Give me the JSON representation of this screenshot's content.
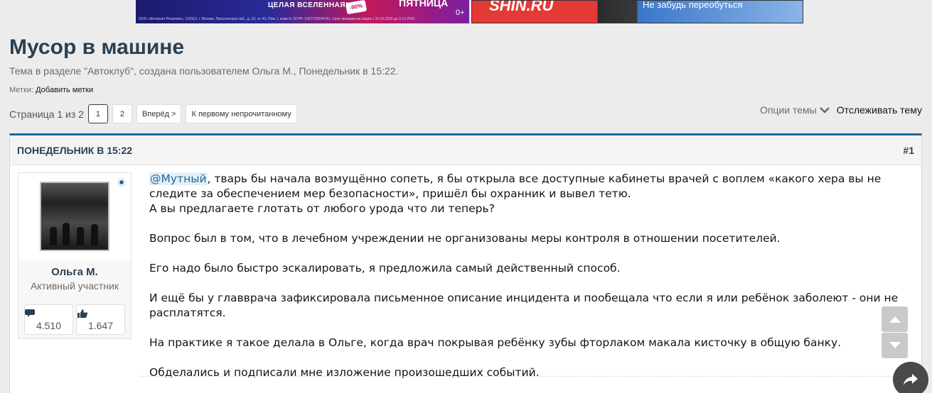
{
  "banners": {
    "left_text_1": "ЦЕЛАЯ ВСЕЛЕННАЯ!",
    "left_badge": "-90%",
    "left_text_2": "ПЯТНИЦА",
    "left_age": "0+",
    "left_fineprint": "ООО «Интернет Решения», 123112, г. Москва, Пресненская наб., д. 10, эт. 41, Пом. I, комн 6; ОГРН: 1027739244741. Срок проведения акции с 30.10.2020 до 3.12.2020.",
    "right_brand": "SHIN.RU",
    "right_text": "Не забудь переобуться"
  },
  "header": {
    "title": "Мусор в машине",
    "subtitle": "Тема в разделе \"Автоклуб\", создана пользователем Ольга М., Понедельник в 15:22.",
    "tags_label": "Метки:",
    "tags_add": "Добавить метки"
  },
  "pager": {
    "label": "Страница 1 из 2",
    "pages": [
      "1",
      "2"
    ],
    "next": "Вперёд >",
    "first_unread": "К первому непрочитанному"
  },
  "thread_tools": {
    "options": "Опции темы",
    "watch": "Отслеживать тему"
  },
  "post": {
    "date": "ПОНЕДЕЛЬНИК В 15:22",
    "number": "#1",
    "mention": "@Мутный",
    "para1_rest": ", тварь бы начала возмущённо сопеть, я бы открыла все доступные кабинеты врачей с воплем «какого хера вы не следите за обеспечением мер безопасности», пришёл бы охранник и вывел тетю.",
    "para1_line2": "А вы предлагаете глотать от любого урода что ли теперь?",
    "para2": "Вопрос был в том, что в лечебном учреждении не организованы меры контроля в отношении посетителей.",
    "para3": "Его надо было быстро эскалировать, я предложила самый действенный способ.",
    "para4": "И ещё бы у главврача зафиксировала письменное описание инцидента и пообещала что если я или ребёнок заболеют - они не расплатятся.",
    "para5": "На практике я такое делала в Ольге, когда врач покрывая ребёнку зубы фторлаком макала кисточку в общую банку.",
    "para6": "Обделались и подписали мне изложение произошедших событий."
  },
  "user": {
    "name": "Ольга М.",
    "role": "Активный участник",
    "messages": "4.510",
    "likes": "1.647",
    "online_color": "#1d6aa0"
  },
  "colors": {
    "accent": "#1d6aa0",
    "title": "#2b3f52"
  }
}
